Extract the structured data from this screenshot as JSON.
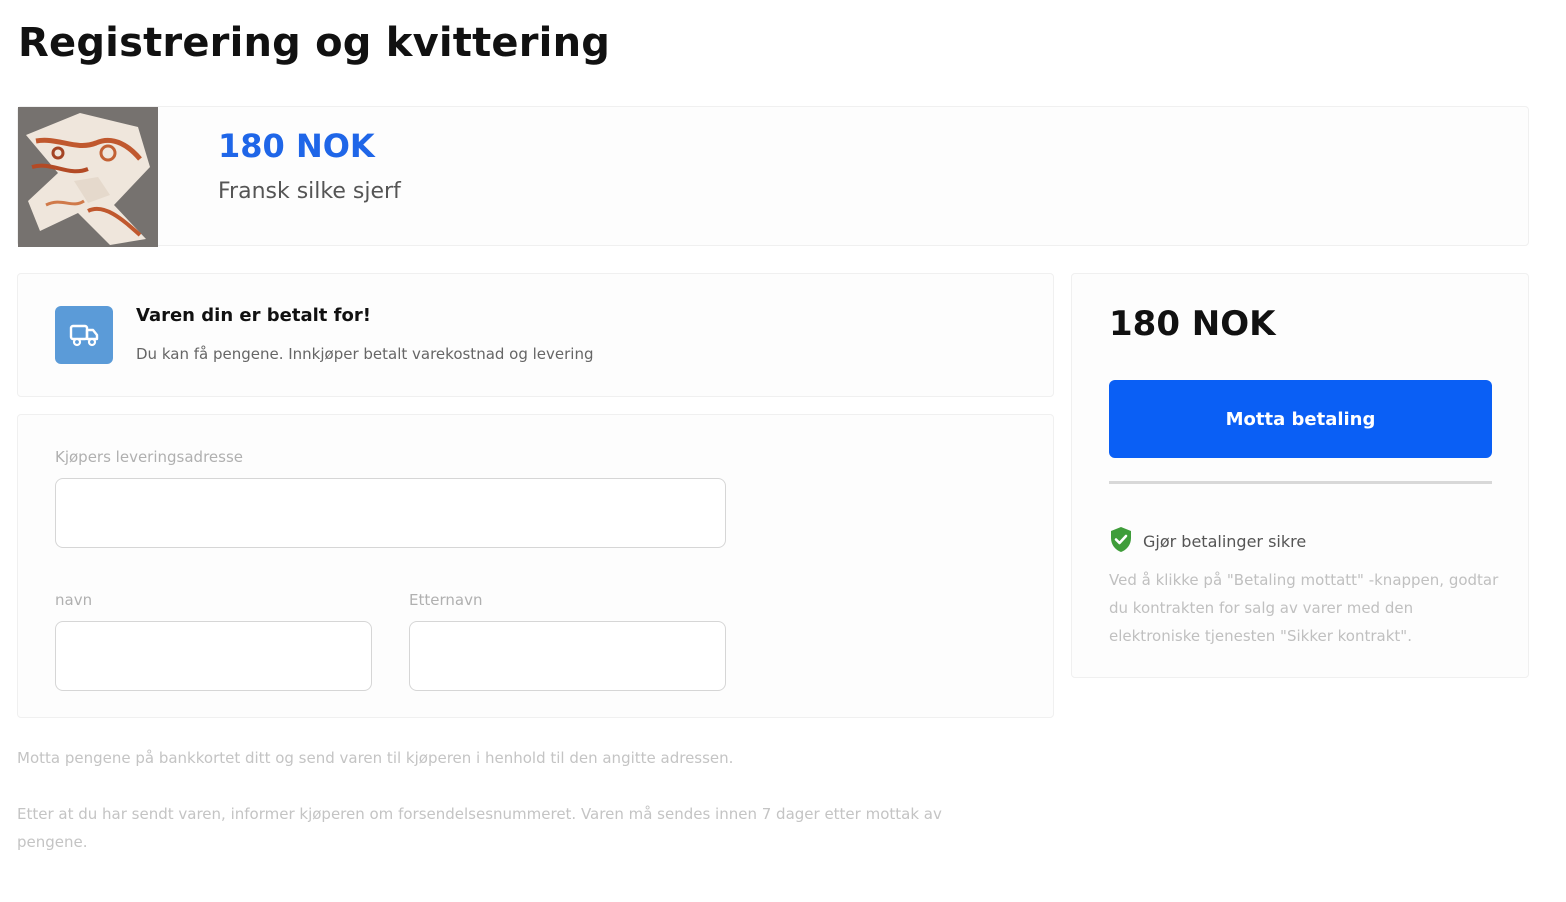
{
  "page": {
    "title": "Registrering og kvittering"
  },
  "product": {
    "price": "180 NOK",
    "name": "Fransk silke sjerf"
  },
  "status": {
    "icon": "truck-icon",
    "title": "Varen din er betalt for!",
    "subtitle": "Du kan få pengene. Innkjøper betalt varekostnad og levering"
  },
  "form": {
    "address_label": "Kjøpers leveringsadresse",
    "address_value": "",
    "first_name_label": "navn",
    "first_name_value": "",
    "last_name_label": "Etternavn",
    "last_name_value": ""
  },
  "notes": {
    "line1": "Motta pengene på bankkortet ditt og send varen til kjøperen i henhold til den angitte adressen.",
    "line2": "Etter at du har sendt varen, informer kjøperen om forsendelsesnummeret. Varen må sendes innen 7 dager etter mottak av pengene."
  },
  "payment": {
    "amount": "180 NOK",
    "button_label": "Motta betaling",
    "secure_label": "Gjør betalinger sikre",
    "terms": "Ved å klikke på \"Betaling mottatt\" -knappen, godtar du kontrakten for salg av varer med den elektroniske tjenesten \"Sikker kontrakt\"."
  },
  "colors": {
    "accent": "#0a5ff5",
    "price_blue": "#1f66e8",
    "truck_bg": "#5b9bd8",
    "shield_green": "#3f9d3a"
  }
}
